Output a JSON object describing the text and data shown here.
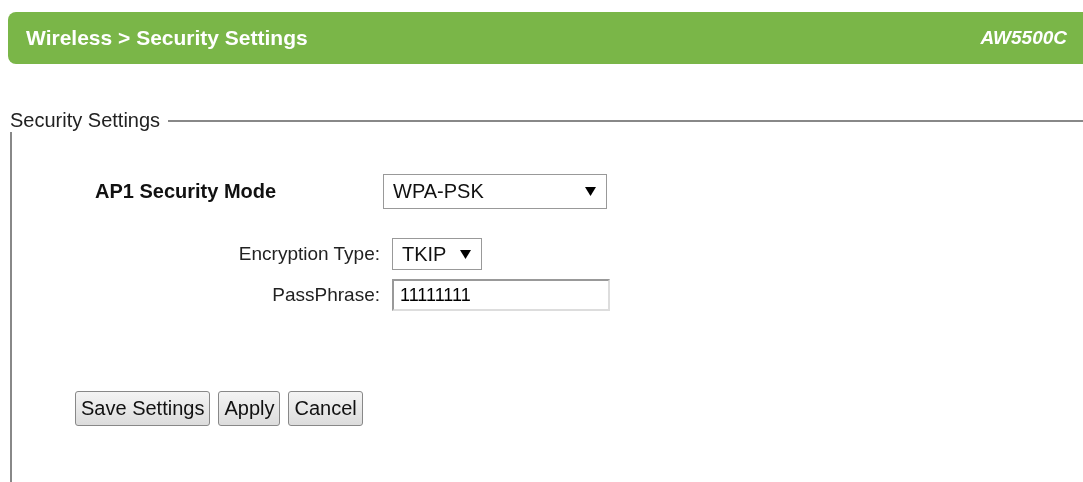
{
  "header": {
    "title": "Wireless > Security Settings",
    "model": "AW5500C"
  },
  "section": {
    "legend": "Security Settings",
    "mode": {
      "label": "AP1 Security Mode",
      "value": "WPA-PSK"
    },
    "fields": [
      {
        "kind": "select",
        "label": "Encryption Type:",
        "value": "TKIP"
      },
      {
        "kind": "text",
        "label": "PassPhrase:",
        "value": "11111111"
      }
    ]
  },
  "buttons": [
    "Save Settings",
    "Apply",
    "Cancel"
  ]
}
